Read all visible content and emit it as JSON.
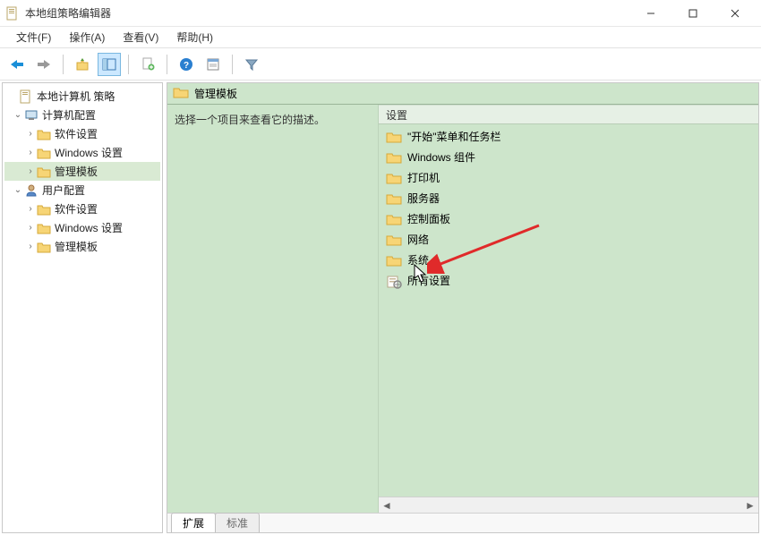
{
  "window": {
    "title": "本地组策略编辑器"
  },
  "menu": {
    "file": "文件(F)",
    "action": "操作(A)",
    "view": "查看(V)",
    "help": "帮助(H)"
  },
  "tree": {
    "root": "本地计算机 策略",
    "computer_config": "计算机配置",
    "computer_software": "软件设置",
    "computer_windows": "Windows 设置",
    "computer_admin": "管理模板",
    "user_config": "用户配置",
    "user_software": "软件设置",
    "user_windows": "Windows 设置",
    "user_admin": "管理模板"
  },
  "header": {
    "title": "管理模板"
  },
  "description": {
    "prompt": "选择一个项目来查看它的描述。"
  },
  "list": {
    "header": "设置",
    "items": [
      {
        "label": "\"开始\"菜单和任务栏",
        "type": "folder"
      },
      {
        "label": "Windows 组件",
        "type": "folder"
      },
      {
        "label": "打印机",
        "type": "folder"
      },
      {
        "label": "服务器",
        "type": "folder"
      },
      {
        "label": "控制面板",
        "type": "folder"
      },
      {
        "label": "网络",
        "type": "folder"
      },
      {
        "label": "系统",
        "type": "folder"
      },
      {
        "label": "所有设置",
        "type": "settings"
      }
    ]
  },
  "tabs": {
    "extended": "扩展",
    "standard": "标准"
  },
  "colors": {
    "panel_bg": "#cde5cb",
    "accent_blue": "#1a6fb8",
    "folder_fill": "#f7d576",
    "folder_stroke": "#d6a93a",
    "arrow_red": "#e02a2a"
  }
}
